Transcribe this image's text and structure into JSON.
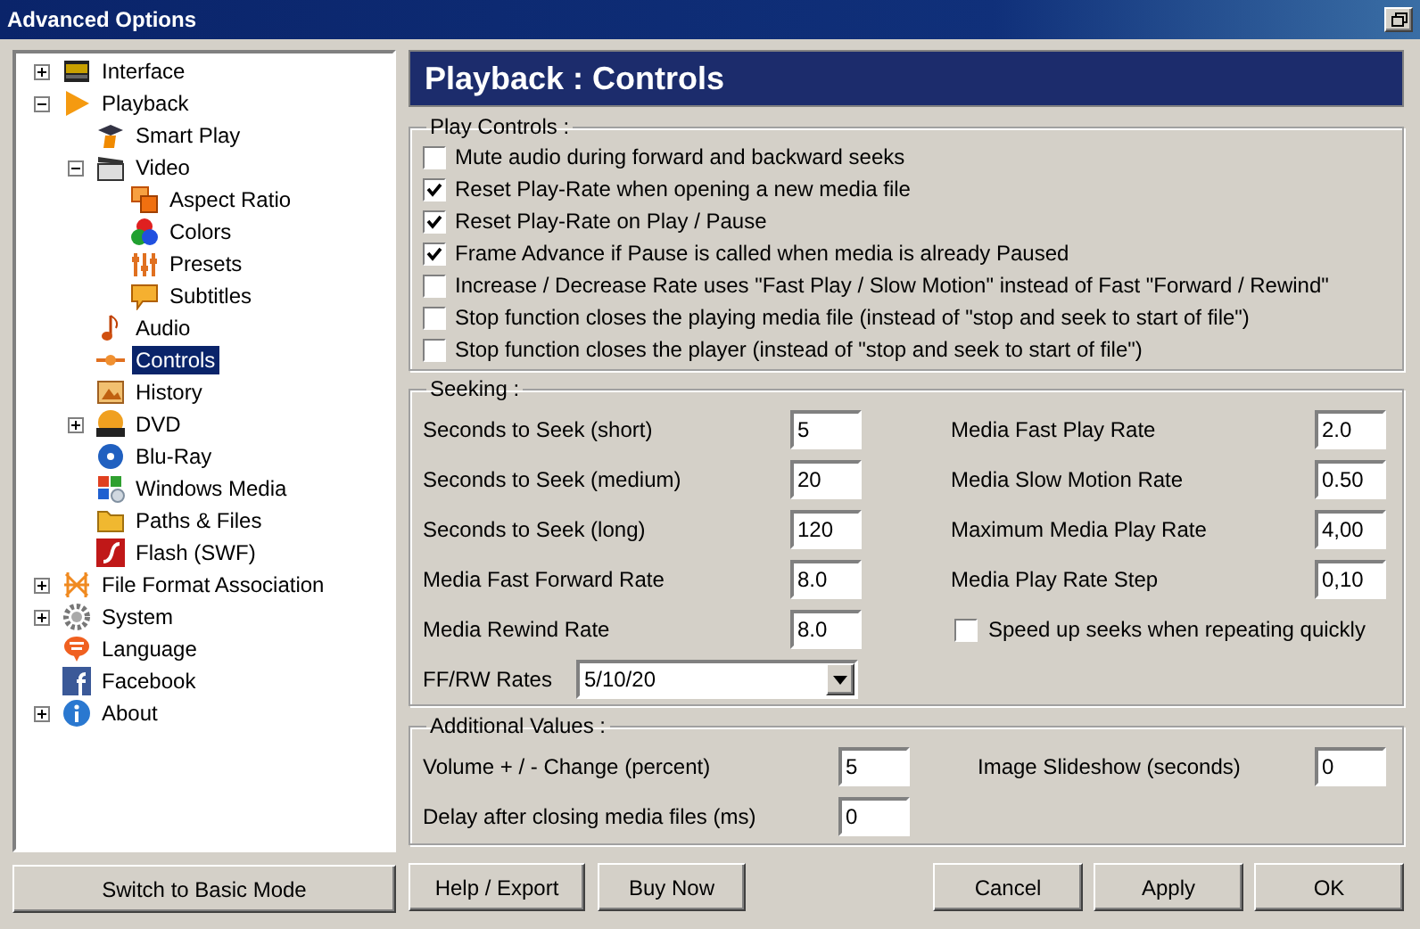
{
  "window": {
    "title": "Advanced Options"
  },
  "tree": [
    {
      "label": "Interface",
      "expanded": false,
      "selected": false
    },
    {
      "label": "Playback",
      "expanded": true,
      "selected": false,
      "children": [
        {
          "label": "Smart Play",
          "selected": false
        },
        {
          "label": "Video",
          "expanded": true,
          "selected": false,
          "children": [
            {
              "label": "Aspect Ratio",
              "selected": false
            },
            {
              "label": "Colors",
              "selected": false
            },
            {
              "label": "Presets",
              "selected": false
            },
            {
              "label": "Subtitles",
              "selected": false
            }
          ]
        },
        {
          "label": "Audio",
          "selected": false
        },
        {
          "label": "Controls",
          "selected": true
        },
        {
          "label": "History",
          "selected": false
        },
        {
          "label": "DVD",
          "expanded": false,
          "selected": false
        },
        {
          "label": "Blu-Ray",
          "selected": false
        },
        {
          "label": "Windows Media",
          "selected": false
        },
        {
          "label": "Paths & Files",
          "selected": false
        },
        {
          "label": "Flash (SWF)",
          "selected": false
        }
      ]
    },
    {
      "label": "File Format Association",
      "expanded": false,
      "selected": false
    },
    {
      "label": "System",
      "expanded": false,
      "selected": false
    },
    {
      "label": "Language",
      "selected": false
    },
    {
      "label": "Facebook",
      "selected": false
    },
    {
      "label": "About",
      "expanded": false,
      "selected": false
    }
  ],
  "mode_button": "Switch to Basic Mode",
  "page_title": "Playback : Controls",
  "play_controls": {
    "title": "Play Controls :",
    "options": [
      {
        "label": "Mute audio during forward and backward seeks",
        "checked": false
      },
      {
        "label": "Reset Play-Rate when opening a new media file",
        "checked": true
      },
      {
        "label": "Reset Play-Rate on Play / Pause",
        "checked": true
      },
      {
        "label": "Frame Advance if Pause is called when media is already Paused",
        "checked": true
      },
      {
        "label": "Increase / Decrease Rate uses \"Fast Play / Slow Motion\" instead of Fast \"Forward / Rewind\"",
        "checked": false
      },
      {
        "label": "Stop function closes the playing media file (instead of \"stop and seek to start of file\")",
        "checked": false
      },
      {
        "label": "Stop function closes the player (instead of \"stop and seek to start of file\")",
        "checked": false
      }
    ]
  },
  "seeking": {
    "title": "Seeking :",
    "left_fields": [
      {
        "label": "Seconds to Seek (short)",
        "value": "5"
      },
      {
        "label": "Seconds to Seek (medium)",
        "value": "20"
      },
      {
        "label": "Seconds to Seek (long)",
        "value": "120"
      },
      {
        "label": "Media Fast Forward Rate",
        "value": "8.0"
      },
      {
        "label": "Media Rewind Rate",
        "value": "8.0"
      }
    ],
    "right_fields": [
      {
        "label": "Media Fast Play Rate",
        "value": "2.0"
      },
      {
        "label": "Media Slow Motion Rate",
        "value": "0.50"
      },
      {
        "label": "Maximum Media Play Rate",
        "value": "4,00"
      },
      {
        "label": "Media Play Rate Step",
        "value": "0,10"
      }
    ],
    "speed_up": {
      "label": "Speed up seeks when repeating quickly",
      "checked": false
    },
    "ff_rw": {
      "label": "FF/RW Rates",
      "value": "5/10/20"
    }
  },
  "additional": {
    "title": "Additional Values :",
    "left_fields": [
      {
        "label": "Volume + / - Change (percent)",
        "value": "5"
      },
      {
        "label": "Delay after closing media files (ms)",
        "value": "0"
      }
    ],
    "right_fields": [
      {
        "label": "Image Slideshow (seconds)",
        "value": "0"
      }
    ]
  },
  "buttons_left": [
    "Help / Export",
    "Buy Now"
  ],
  "buttons_right": [
    "Cancel",
    "Apply",
    "OK"
  ]
}
